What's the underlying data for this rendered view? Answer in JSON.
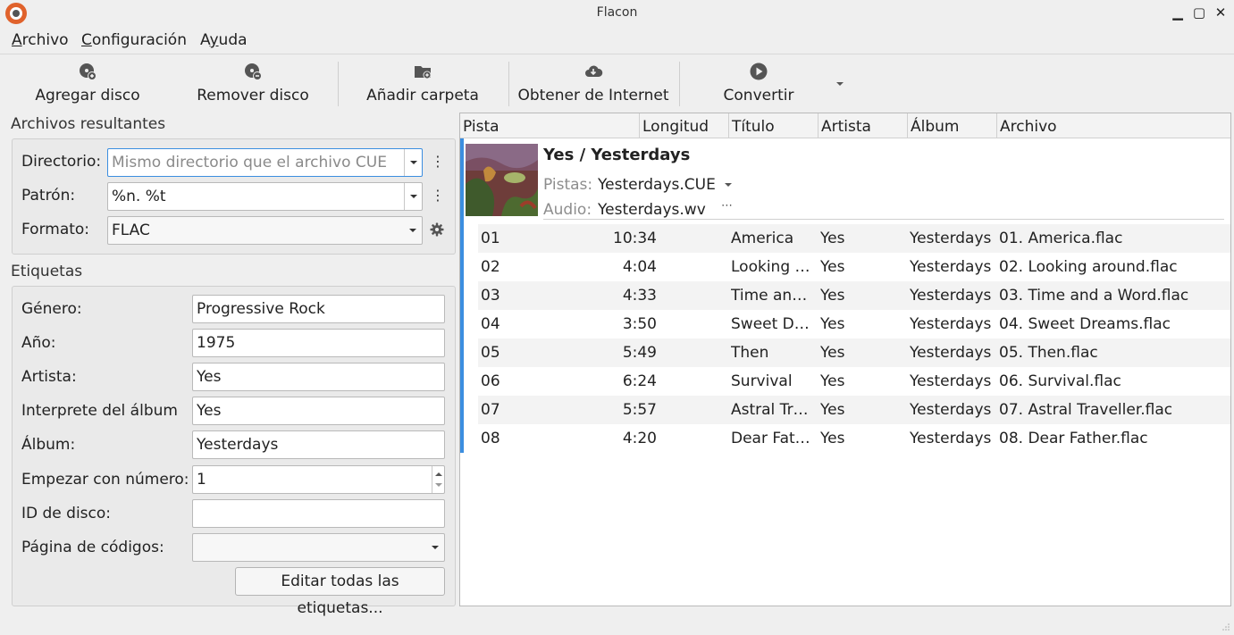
{
  "window": {
    "title": "Flacon"
  },
  "menubar": [
    {
      "acc": "A",
      "rest": "rchivo"
    },
    {
      "acc": "C",
      "rest": "onfiguración"
    },
    {
      "pre": "A",
      "acc": "y",
      "rest": "uda"
    }
  ],
  "toolbar": {
    "add_disc": "Agregar disco",
    "remove_disc": "Remover disco",
    "add_folder": "Añadir carpeta",
    "get_internet": "Obtener de Internet",
    "convert": "Convertir"
  },
  "output": {
    "section_title": "Archivos resultantes",
    "directory_label": "Directorio:",
    "directory_placeholder": "Mismo directorio que el archivo CUE",
    "pattern_label": "Patrón:",
    "pattern_value": "%n. %t",
    "format_label": "Formato:",
    "format_value": "FLAC"
  },
  "tags": {
    "section_title": "Etiquetas",
    "genre_label": "Género:",
    "genre_value": "Progressive Rock",
    "year_label": "Año:",
    "year_value": "1975",
    "artist_label": "Artista:",
    "artist_value": "Yes",
    "album_artist_label": "Interprete del álbum",
    "album_artist_value": "Yes",
    "album_label": "Álbum:",
    "album_value": "Yesterdays",
    "start_num_label": "Empezar con número:",
    "start_num_value": "1",
    "disc_id_label": "ID de disco:",
    "disc_id_value": "",
    "codepage_label": "Página de códigos:",
    "codepage_value": "",
    "edit_all_button": "Editar todas las etiquetas..."
  },
  "tracklist": {
    "columns": [
      "Pista",
      "Longitud",
      "Título",
      "Artista",
      "Álbum",
      "Archivo"
    ],
    "disc": {
      "title": "Yes / Yesterdays",
      "tracks_label": "Pistas:",
      "tracks_value": "Yesterdays.CUE",
      "audio_label": "Audio:",
      "audio_value": "Yesterdays.wv"
    },
    "rows": [
      {
        "num": "01",
        "len": "10:34",
        "title": "America",
        "artist": "Yes",
        "album": "Yesterdays",
        "file": "01. America.flac"
      },
      {
        "num": "02",
        "len": "4:04",
        "title": "Looking …",
        "artist": "Yes",
        "album": "Yesterdays",
        "file": "02. Looking around.flac"
      },
      {
        "num": "03",
        "len": "4:33",
        "title": "Time an…",
        "artist": "Yes",
        "album": "Yesterdays",
        "file": "03. Time and a Word.flac"
      },
      {
        "num": "04",
        "len": "3:50",
        "title": "Sweet D…",
        "artist": "Yes",
        "album": "Yesterdays",
        "file": "04. Sweet Dreams.flac"
      },
      {
        "num": "05",
        "len": "5:49",
        "title": "Then",
        "artist": "Yes",
        "album": "Yesterdays",
        "file": "05. Then.flac"
      },
      {
        "num": "06",
        "len": "6:24",
        "title": "Survival",
        "artist": "Yes",
        "album": "Yesterdays",
        "file": "06. Survival.flac"
      },
      {
        "num": "07",
        "len": "5:57",
        "title": "Astral Tr…",
        "artist": "Yes",
        "album": "Yesterdays",
        "file": "07. Astral Traveller.flac"
      },
      {
        "num": "08",
        "len": "4:20",
        "title": "Dear Fat…",
        "artist": "Yes",
        "album": "Yesterdays",
        "file": "08. Dear Father.flac"
      }
    ]
  }
}
